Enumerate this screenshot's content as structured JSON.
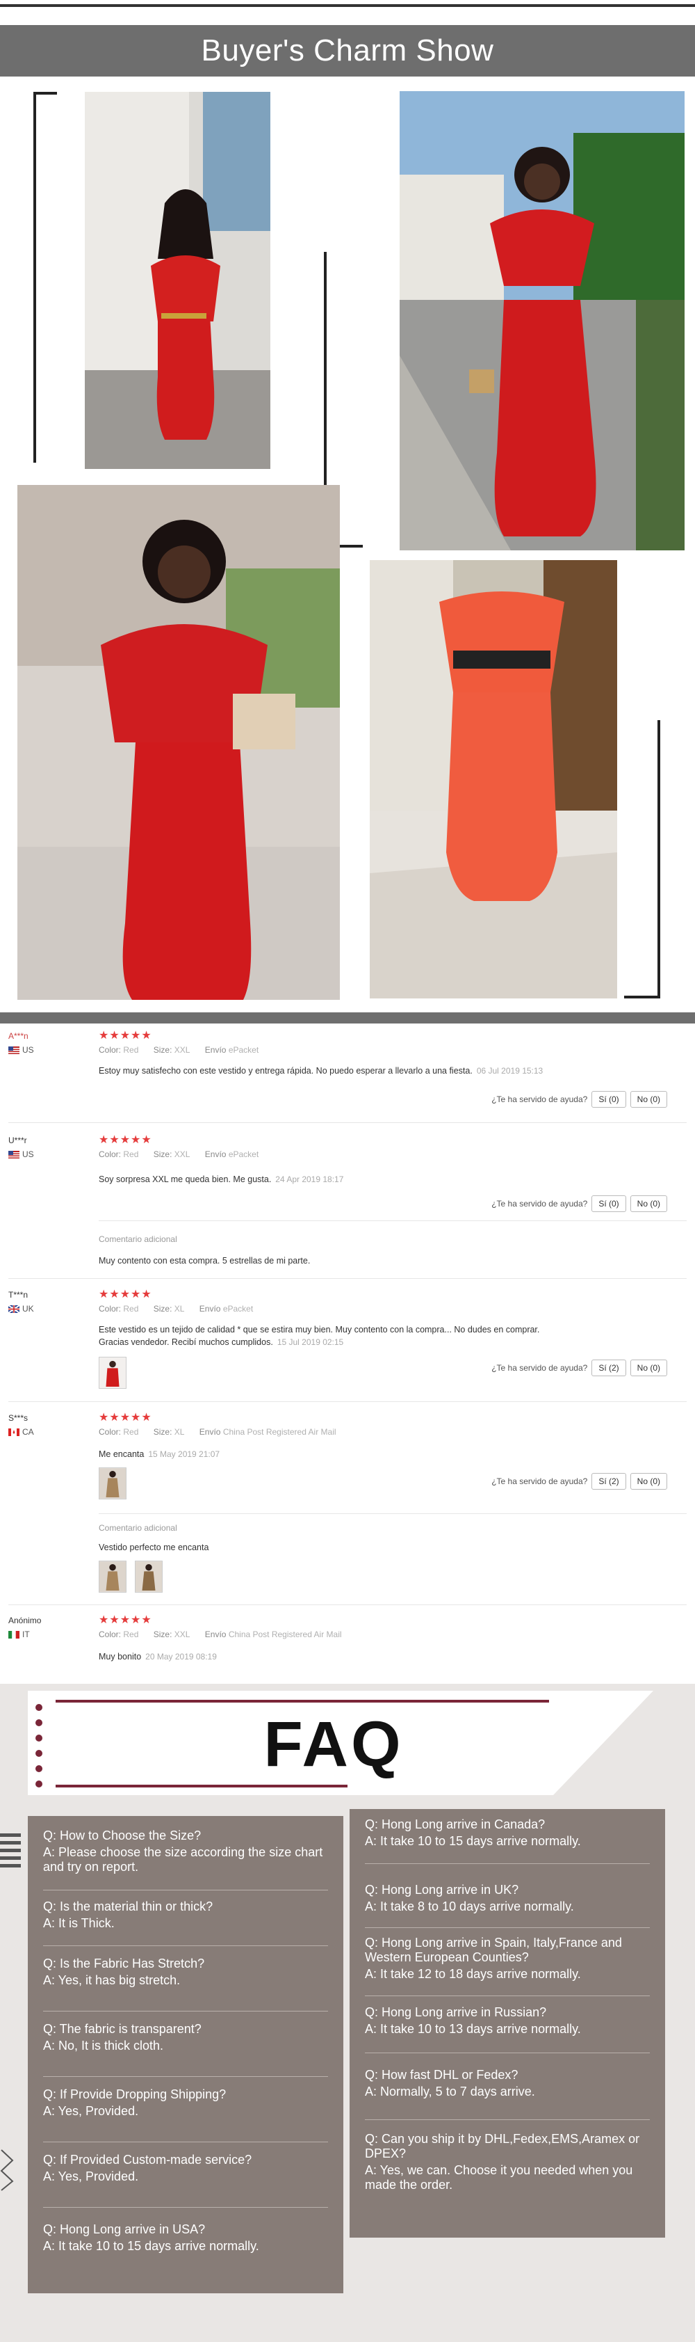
{
  "show": {
    "title": "Buyer's Charm Show"
  },
  "reviews": [
    {
      "name": "A***n",
      "country": "US",
      "stars": "★★★★★",
      "color_label": "Color:",
      "color": "Red",
      "size_label": "Size:",
      "size": "XXL",
      "ship_label": "Envío",
      "ship": "ePacket",
      "text": "Estoy muy satisfecho con este vestido y entrega rápida. No puedo esperar a llevarlo a una fiesta.",
      "date": "06 Jul 2019 15:13",
      "helpful": "¿Te ha servido de ayuda?",
      "yes": "Sí (0)",
      "no": "No (0)"
    },
    {
      "name": "U***r",
      "country": "US",
      "stars": "★★★★★",
      "color_label": "Color:",
      "color": "Red",
      "size_label": "Size:",
      "size": "XXL",
      "ship_label": "Envío",
      "ship": "ePacket",
      "text": "Soy sorpresa XXL me queda bien. Me gusta.",
      "date": "24 Apr 2019 18:17",
      "helpful": "¿Te ha servido de ayuda?",
      "yes": "Sí (0)",
      "no": "No (0)",
      "extra_label": "Comentario adicional",
      "extra_text": "Muy contento con esta compra. 5 estrellas de mi parte."
    },
    {
      "name": "T***n",
      "country": "UK",
      "stars": "★★★★★",
      "color_label": "Color:",
      "color": "Red",
      "size_label": "Size:",
      "size": "XL",
      "ship_label": "Envío",
      "ship": "ePacket",
      "text": "Este vestido es un tejido de calidad * que se estira muy bien. Muy contento con la compra... No dudes en comprar.",
      "text2": "Gracias vendedor. Recibí muchos cumplidos.",
      "date": "15 Jul 2019 02:15",
      "helpful": "¿Te ha servido de ayuda?",
      "yes": "Sí (2)",
      "no": "No (0)"
    },
    {
      "name": "S***s",
      "country": "CA",
      "stars": "★★★★★",
      "color_label": "Color:",
      "color": "Red",
      "size_label": "Size:",
      "size": "XL",
      "ship_label": "Envío",
      "ship": "China Post Registered Air Mail",
      "text": "Me encanta",
      "date": "15 May 2019 21:07",
      "helpful": "¿Te ha servido de ayuda?",
      "yes": "Sí (2)",
      "no": "No (0)",
      "extra_label": "Comentario adicional",
      "extra_text": "Vestido perfecto me encanta"
    },
    {
      "name": "Anónimo",
      "country": "IT",
      "stars": "★★★★★",
      "color_label": "Color:",
      "color": "Red",
      "size_label": "Size:",
      "size": "XXL",
      "ship_label": "Envío",
      "ship": "China Post Registered Air Mail",
      "text": "Muy bonito",
      "date": "20 May 2019 08:19"
    }
  ],
  "faq": {
    "title": "FAQ",
    "accent": "#7a2638",
    "panel_color": "#877c77",
    "left": [
      {
        "q": "Q: How to Choose the Size?",
        "a": "A: Please choose the size according the size chart and try on report."
      },
      {
        "q": "Q: Is the material thin or thick?",
        "a": "A: It is Thick."
      },
      {
        "q": "Q: Is the Fabric Has Stretch?",
        "a": "A: Yes, it has big stretch."
      },
      {
        "q": "Q: The fabric is transparent?",
        "a": "A: No, It is thick cloth."
      },
      {
        "q": "Q: If Provide Dropping Shipping?",
        "a": "A: Yes, Provided."
      },
      {
        "q": "Q: If Provided Custom-made service?",
        "a": "A: Yes, Provided."
      },
      {
        "q": "Q: Hong Long arrive in USA?",
        "a": "A: It take 10 to 15 days arrive normally."
      }
    ],
    "right": [
      {
        "q": "Q: Hong Long arrive in Canada?",
        "a": "A: It take 10 to 15 days arrive normally."
      },
      {
        "q": "Q: Hong Long arrive in UK?",
        "a": "A: It take 8 to 10 days arrive normally."
      },
      {
        "q": "Q: Hong Long arrive in Spain, Italy,France and Western European Counties?",
        "a": "A: It take 12 to 18 days arrive normally."
      },
      {
        "q": "Q: Hong Long arrive in Russian?",
        "a": "A: It take 10 to 13 days arrive normally."
      },
      {
        "q": "Q: How fast DHL or Fedex?",
        "a": "A: Normally, 5 to 7 days arrive."
      },
      {
        "q": "Q: Can you ship it by DHL,Fedex,EMS,Aramex or DPEX?",
        "a": "A: Yes, we can. Choose it you needed when you made the order."
      }
    ]
  }
}
